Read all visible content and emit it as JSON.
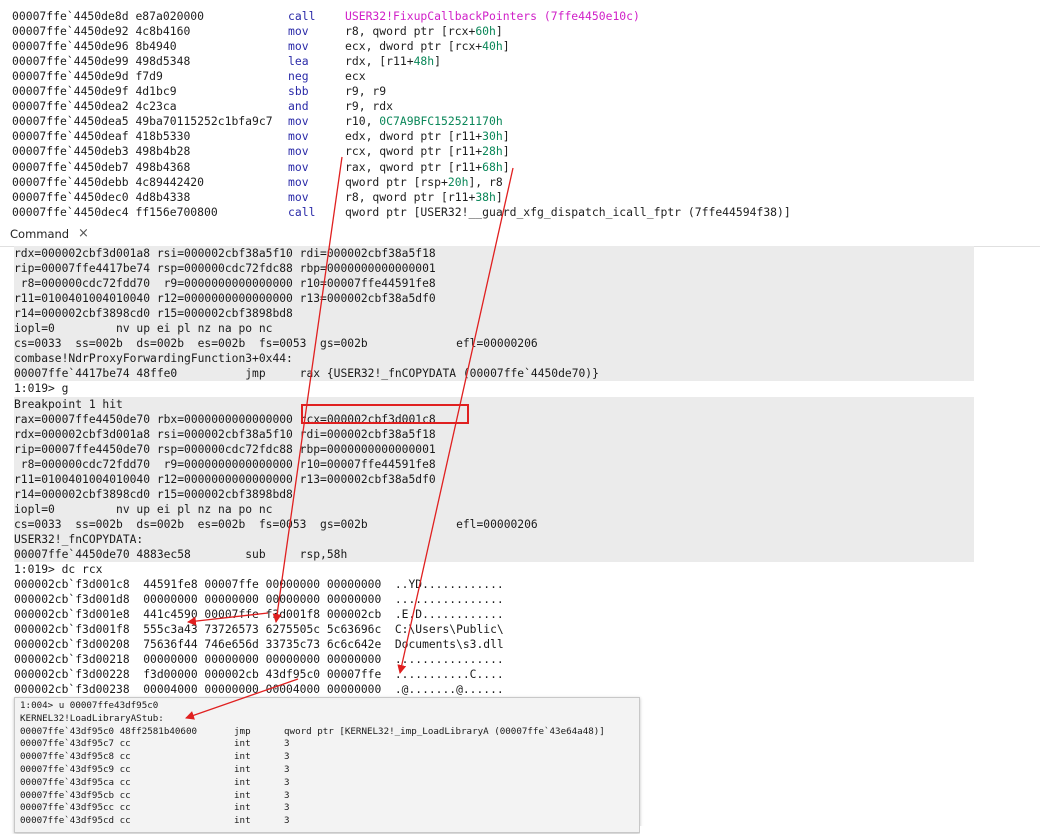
{
  "disasm": [
    {
      "addr": "00007ffe`4450de8d e87a020000",
      "mn": "call",
      "op": [
        {
          "t": "USER32!FixupCallbackPointers (7ffe4450e10c)",
          "c": "pink"
        }
      ],
      "pink": true
    },
    {
      "addr": "00007ffe`4450de92 4c8b4160",
      "mn": "mov",
      "op": [
        {
          "t": "r8, qword ptr [rcx+"
        },
        {
          "t": "60h",
          "c": "hex"
        },
        {
          "t": "]"
        }
      ]
    },
    {
      "addr": "00007ffe`4450de96 8b4940",
      "mn": "mov",
      "op": [
        {
          "t": "ecx, dword ptr [rcx+"
        },
        {
          "t": "40h",
          "c": "hex"
        },
        {
          "t": "]"
        }
      ]
    },
    {
      "addr": "00007ffe`4450de99 498d5348",
      "mn": "lea",
      "op": [
        {
          "t": "rdx, [r11+"
        },
        {
          "t": "48h",
          "c": "hex"
        },
        {
          "t": "]"
        }
      ]
    },
    {
      "addr": "00007ffe`4450de9d f7d9",
      "mn": "neg",
      "op": [
        {
          "t": "ecx"
        }
      ]
    },
    {
      "addr": "00007ffe`4450de9f 4d1bc9",
      "mn": "sbb",
      "op": [
        {
          "t": "r9, r9"
        }
      ]
    },
    {
      "addr": "00007ffe`4450dea2 4c23ca",
      "mn": "and",
      "op": [
        {
          "t": "r9, rdx"
        }
      ]
    },
    {
      "addr": "00007ffe`4450dea5 49ba70115252c1bfa9c7",
      "mn": "mov",
      "op": [
        {
          "t": "r10, "
        },
        {
          "t": "0C7A9BFC152521170h",
          "c": "hex"
        }
      ]
    },
    {
      "addr": "00007ffe`4450deaf 418b5330",
      "mn": "mov",
      "op": [
        {
          "t": "edx, dword ptr [r11+"
        },
        {
          "t": "30h",
          "c": "hex"
        },
        {
          "t": "]"
        }
      ]
    },
    {
      "addr": "00007ffe`4450deb3 498b4b28",
      "mn": "mov",
      "op": [
        {
          "t": "rcx, qword ptr [r11+"
        },
        {
          "t": "28h",
          "c": "hex"
        },
        {
          "t": "]"
        }
      ]
    },
    {
      "addr": "00007ffe`4450deb7 498b4368",
      "mn": "mov",
      "op": [
        {
          "t": "rax, qword ptr [r11+"
        },
        {
          "t": "68h",
          "c": "hex"
        },
        {
          "t": "]"
        }
      ]
    },
    {
      "addr": "00007ffe`4450debb 4c89442420",
      "mn": "mov",
      "op": [
        {
          "t": "qword ptr [rsp+"
        },
        {
          "t": "20h",
          "c": "hex"
        },
        {
          "t": "], r8"
        }
      ]
    },
    {
      "addr": "00007ffe`4450dec0 4d8b4338",
      "mn": "mov",
      "op": [
        {
          "t": "r8, qword ptr [r11+"
        },
        {
          "t": "38h",
          "c": "hex"
        },
        {
          "t": "]"
        }
      ]
    },
    {
      "addr": "00007ffe`4450dec4 ff156e700800",
      "mn": "call",
      "op": [
        {
          "t": "qword ptr [USER32!__guard_xfg_dispatch_icall_fptr (7ffe44594f38)]"
        }
      ]
    }
  ],
  "tab": {
    "label": "Command",
    "close": "×"
  },
  "command": [
    {
      "text": "rdx=000002cbf3d001a8 rsi=000002cbf38a5f10 rdi=000002cbf38a5f18",
      "shade": true
    },
    {
      "text": "rip=00007ffe4417be74 rsp=000000cdc72fdc88 rbp=0000000000000001",
      "shade": true
    },
    {
      "text": " r8=000000cdc72fdd70  r9=0000000000000000 r10=00007ffe44591fe8",
      "shade": true
    },
    {
      "text": "r11=0100401004010040 r12=0000000000000000 r13=000002cbf38a5df0",
      "shade": true
    },
    {
      "text": "r14=000002cbf3898cd0 r15=000002cbf3898bd8",
      "shade": true
    },
    {
      "text": "iopl=0         nv up ei pl nz na po nc",
      "shade": true
    },
    {
      "text": "cs=0033  ss=002b  ds=002b  es=002b  fs=0053  gs=002b             efl=00000206",
      "shade": true
    },
    {
      "text": "combase!NdrProxyForwardingFunction3+0x44:",
      "shade": true
    },
    {
      "text": "00007ffe`4417be74 48ffe0          jmp     rax {USER32!_fnCOPYDATA (00007ffe`4450de70)}",
      "shade": true
    },
    {
      "text": "1:019> g",
      "shade": false
    },
    {
      "text": "Breakpoint 1 hit",
      "shade": true
    },
    {
      "text": "rax=00007ffe4450de70 rbx=0000000000000000 rcx=000002cbf3d001c8",
      "shade": true
    },
    {
      "text": "rdx=000002cbf3d001a8 rsi=000002cbf38a5f10 rdi=000002cbf38a5f18",
      "shade": true
    },
    {
      "text": "rip=00007ffe4450de70 rsp=000000cdc72fdc88 rbp=0000000000000001",
      "shade": true
    },
    {
      "text": " r8=000000cdc72fdd70  r9=0000000000000000 r10=00007ffe44591fe8",
      "shade": true
    },
    {
      "text": "r11=0100401004010040 r12=0000000000000000 r13=000002cbf38a5df0",
      "shade": true
    },
    {
      "text": "r14=000002cbf3898cd0 r15=000002cbf3898bd8",
      "shade": true
    },
    {
      "text": "iopl=0         nv up ei pl nz na po nc",
      "shade": true
    },
    {
      "text": "cs=0033  ss=002b  ds=002b  es=002b  fs=0053  gs=002b             efl=00000206",
      "shade": true
    },
    {
      "text": "USER32!_fnCOPYDATA:",
      "shade": true
    },
    {
      "text": "00007ffe`4450de70 4883ec58        sub     rsp,58h",
      "shade": true
    },
    {
      "text": "1:019> dc rcx",
      "shade": false
    },
    {
      "text": "000002cb`f3d001c8  44591fe8 00007ffe 00000000 00000000  ..YD............",
      "shade": false
    },
    {
      "text": "000002cb`f3d001d8  00000000 00000000 00000000 00000000  ................",
      "shade": false
    },
    {
      "text": "000002cb`f3d001e8  441c4590 00007ffe f3d001f8 000002cb  .E.D............",
      "shade": false
    },
    {
      "text": "000002cb`f3d001f8  555c3a43 73726573 6275505c 5c63696c  C:\\Users\\Public\\",
      "shade": false
    },
    {
      "text": "000002cb`f3d00208  75636f44 746e656d 33735c73 6c6c642e  Documents\\s3.dll",
      "shade": false
    },
    {
      "text": "000002cb`f3d00218  00000000 00000000 00000000 00000000  ................",
      "shade": false
    },
    {
      "text": "000002cb`f3d00228  f3d00000 000002cb 43df95c0 00007ffe  ...........C....",
      "shade": false
    },
    {
      "text": "000002cb`f3d00238  00004000 00000000 00004000 00000000  .@.......@......",
      "shade": false
    }
  ],
  "popup": {
    "header": [
      "1:004> u 00007ffe43df95c0",
      "KERNEL32!LoadLibraryAStub:"
    ],
    "rows": [
      {
        "addr": "00007ffe`43df95c0 48ff2581b40600",
        "mn": "jmp",
        "op": "qword ptr [KERNEL32!_imp_LoadLibraryA (00007ffe`43e64a48)]"
      },
      {
        "addr": "00007ffe`43df95c7 cc",
        "mn": "int",
        "op": "3"
      },
      {
        "addr": "00007ffe`43df95c8 cc",
        "mn": "int",
        "op": "3"
      },
      {
        "addr": "00007ffe`43df95c9 cc",
        "mn": "int",
        "op": "3"
      },
      {
        "addr": "00007ffe`43df95ca cc",
        "mn": "int",
        "op": "3"
      },
      {
        "addr": "00007ffe`43df95cb cc",
        "mn": "int",
        "op": "3"
      },
      {
        "addr": "00007ffe`43df95cc cc",
        "mn": "int",
        "op": "3"
      },
      {
        "addr": "00007ffe`43df95cd cc",
        "mn": "int",
        "op": "3"
      }
    ]
  },
  "colors": {
    "mnemonic": "#2a2aa8",
    "hex": "#098658",
    "call_target": "#d020c8",
    "annotation": "#e02020",
    "shade": "#ebebeb"
  }
}
